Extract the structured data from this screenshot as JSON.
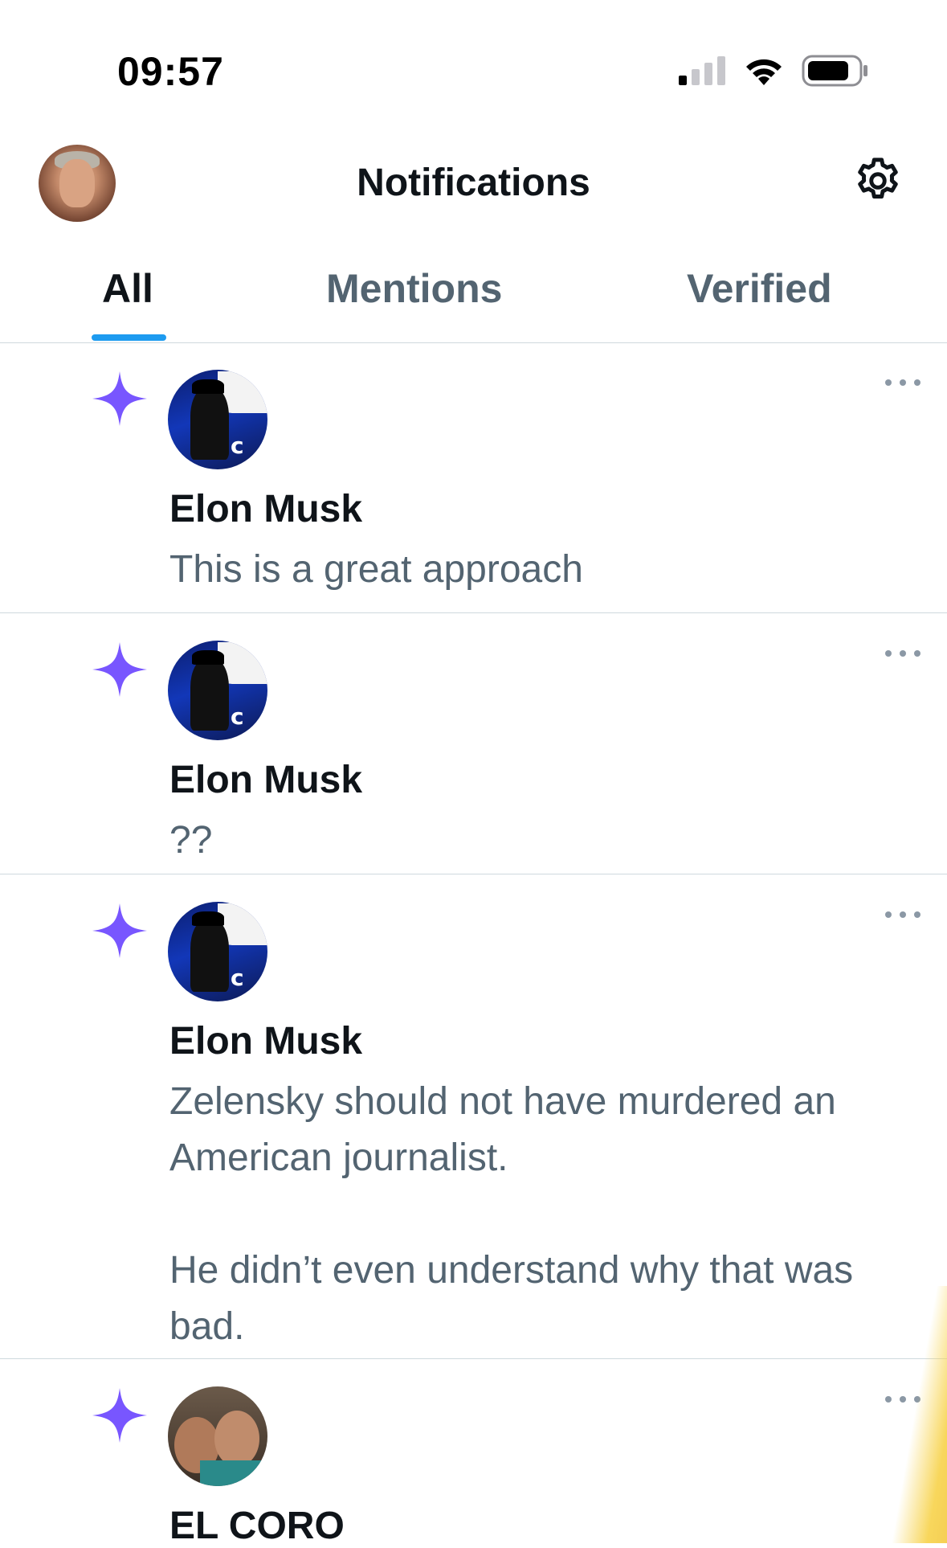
{
  "status_bar": {
    "time": "09:57"
  },
  "header": {
    "title": "Notifications"
  },
  "tabs": [
    {
      "label": "All",
      "active": true
    },
    {
      "label": "Mentions",
      "active": false
    },
    {
      "label": "Verified",
      "active": false
    }
  ],
  "colors": {
    "accent": "#1d9bf0",
    "sparkle": "#7856ff",
    "secondary_text": "#536471",
    "primary_text": "#0f1419"
  },
  "icons": {
    "sparkle": "sparkle-icon",
    "more": "more-icon",
    "settings": "gear-icon"
  },
  "notifications": [
    {
      "user": "Elon Musk",
      "text": "This is a great approach"
    },
    {
      "user": "Elon Musk",
      "text": "??"
    },
    {
      "user": "Elon Musk",
      "text": "Zelensky should not have murdered an American journalist.\n\nHe didn’t even understand why that was bad."
    },
    {
      "user": "EL CORO",
      "text": ""
    }
  ]
}
